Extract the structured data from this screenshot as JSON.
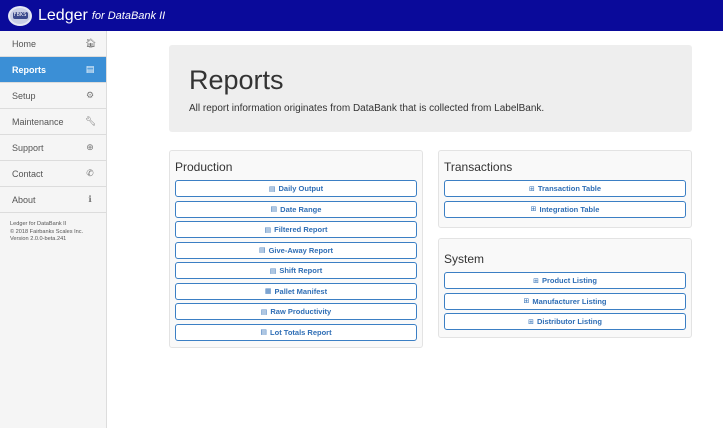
{
  "header": {
    "brand": "Ledger",
    "subtitle": "for DataBank II",
    "logo_text": "FBKS"
  },
  "sidebar": {
    "items": [
      {
        "label": "Home",
        "icon": "home-icon",
        "glyph": "🏠︎"
      },
      {
        "label": "Reports",
        "icon": "list-icon",
        "glyph": "▤"
      },
      {
        "label": "Setup",
        "icon": "gear-icon",
        "glyph": "⚙"
      },
      {
        "label": "Maintenance",
        "icon": "wrench-icon",
        "glyph": "🔧︎"
      },
      {
        "label": "Support",
        "icon": "lifebuoy-icon",
        "glyph": "⊕"
      },
      {
        "label": "Contact",
        "icon": "phone-icon",
        "glyph": "✆"
      },
      {
        "label": "About",
        "icon": "info-icon",
        "glyph": "ℹ"
      }
    ],
    "active_index": 1,
    "info": {
      "line1": "Ledger for DataBank II",
      "line2": "© 2018 Fairbanks Scales Inc.",
      "line3": "Version 2.0.0-beta.241"
    }
  },
  "jumbotron": {
    "title": "Reports",
    "description": "All report information originates from DataBank that is collected from LabelBank."
  },
  "panels": {
    "production": {
      "title": "Production",
      "buttons": [
        {
          "label": "Daily Output",
          "glyph": "▤"
        },
        {
          "label": "Date Range",
          "glyph": "▤"
        },
        {
          "label": "Filtered Report",
          "glyph": "▤"
        },
        {
          "label": "Give-Away Report",
          "glyph": "▤"
        },
        {
          "label": "Shift Report",
          "glyph": "▤"
        },
        {
          "label": "Pallet Manifest",
          "glyph": "▦"
        },
        {
          "label": "Raw Productivity",
          "glyph": "▤"
        },
        {
          "label": "Lot Totals Report",
          "glyph": "▤"
        }
      ]
    },
    "transactions": {
      "title": "Transactions",
      "buttons": [
        {
          "label": "Transaction Table",
          "glyph": "⊞"
        },
        {
          "label": "Integration Table",
          "glyph": "⊞"
        }
      ]
    },
    "system": {
      "title": "System",
      "buttons": [
        {
          "label": "Product Listing",
          "glyph": "⊞"
        },
        {
          "label": "Manufacturer Listing",
          "glyph": "⊞"
        },
        {
          "label": "Distributor Listing",
          "glyph": "⊞"
        }
      ]
    }
  },
  "colors": {
    "topbar": "#0a0a9a",
    "active_nav": "#3b8fd6",
    "button_border": "#3b7fc4",
    "button_text": "#2f6eb5"
  }
}
